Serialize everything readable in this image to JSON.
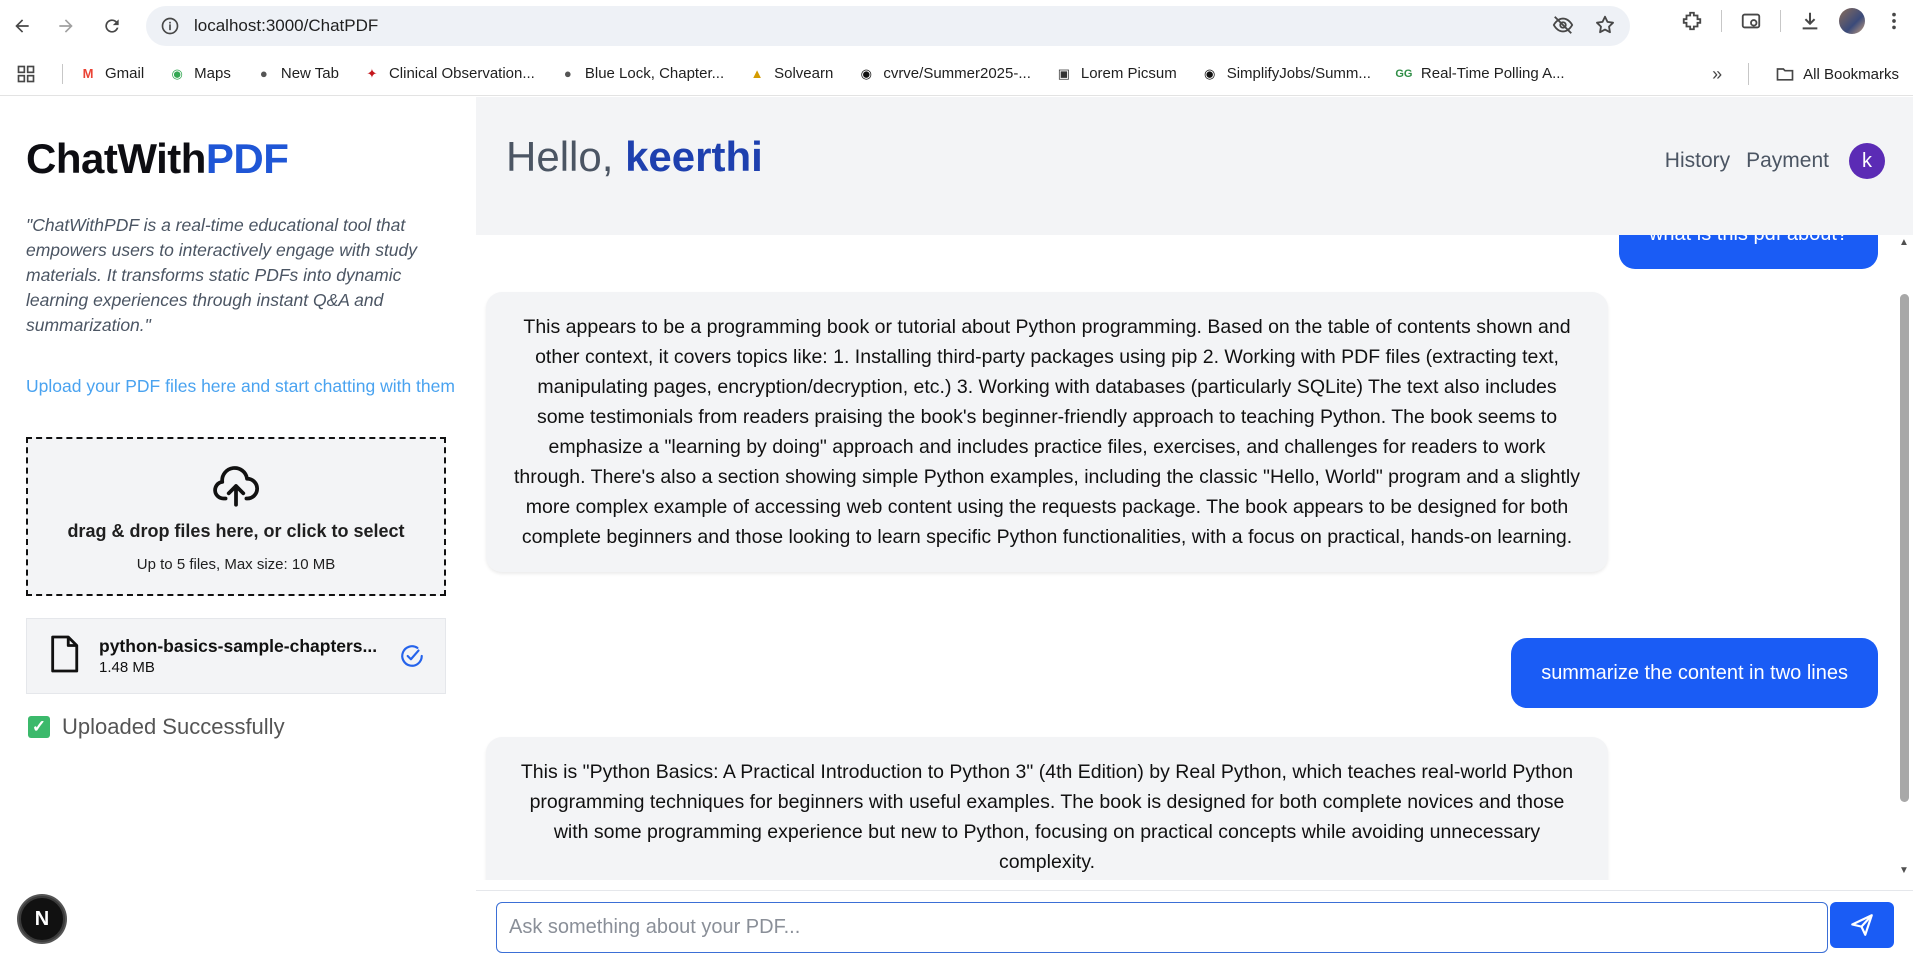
{
  "browser": {
    "url": "localhost:3000/ChatPDF",
    "bookmarks": [
      {
        "label": "Gmail",
        "icon": "gmail-icon"
      },
      {
        "label": "Maps",
        "icon": "maps-icon"
      },
      {
        "label": "New Tab",
        "icon": "globe-icon"
      },
      {
        "label": "Clinical Observation...",
        "icon": "bird-icon"
      },
      {
        "label": "Blue Lock, Chapter...",
        "icon": "globe-icon"
      },
      {
        "label": "Solvearn",
        "icon": "solvearn-icon"
      },
      {
        "label": "cvrve/Summer2025-...",
        "icon": "github-icon"
      },
      {
        "label": "Lorem Picsum",
        "icon": "image-icon"
      },
      {
        "label": "SimplifyJobs/Summ...",
        "icon": "github-icon"
      },
      {
        "label": "Real-Time Polling A...",
        "icon": "gfg-icon"
      }
    ],
    "all_bookmarks": "All Bookmarks"
  },
  "sidebar": {
    "brand_main": "ChatWith",
    "brand_accent": "PDF",
    "description": "\"ChatWithPDF is a real-time educational tool that empowers users to interactively engage with study materials. It transforms static PDFs into dynamic learning experiences through instant Q&A and summarization.\"",
    "upload_link": "Upload your PDF files here and start chatting with them",
    "dropzone_title": "drag & drop files here, or click to select",
    "dropzone_sub": "Up to 5 files, Max size: 10 MB",
    "file_name": "python-basics-sample-chapters...",
    "file_size": "1.48 MB",
    "status": "Uploaded Successfully",
    "badge": "N"
  },
  "header": {
    "greeting": "Hello,",
    "username": "keerthi",
    "nav_history": "History",
    "nav_payment": "Payment",
    "avatar_letter": "k"
  },
  "chat": {
    "user_msg_1": "what is this pdf about?",
    "bot_msg_1": "This appears to be a programming book or tutorial about Python programming. Based on the table of contents shown and other context, it covers topics like: 1. Installing third-party packages using pip 2. Working with PDF files (extracting text, manipulating pages, encryption/decryption, etc.) 3. Working with databases (particularly SQLite) The text also includes some testimonials from readers praising the book's beginner-friendly approach to teaching Python. The book seems to emphasize a \"learning by doing\" approach and includes practice files, exercises, and challenges for readers to work through. There's also a section showing simple Python examples, including the classic \"Hello, World\" program and a slightly more complex example of accessing web content using the requests package. The book appears to be designed for both complete beginners and those looking to learn specific Python functionalities, with a focus on practical, hands-on learning.",
    "user_msg_2": "summarize the content in two lines",
    "bot_msg_2": "This is \"Python Basics: A Practical Introduction to Python 3\" (4th Edition) by Real Python, which teaches real-world Python programming techniques for beginners with useful examples. The book is designed for both complete novices and those with some programming experience but new to Python, focusing on practical concepts while avoiding unnecessary complexity."
  },
  "composer": {
    "placeholder": "Ask something about your PDF..."
  },
  "colors": {
    "accent": "#1f56d6",
    "user_bubble": "#1a5cf5",
    "header_bg": "#f3f4f6"
  }
}
